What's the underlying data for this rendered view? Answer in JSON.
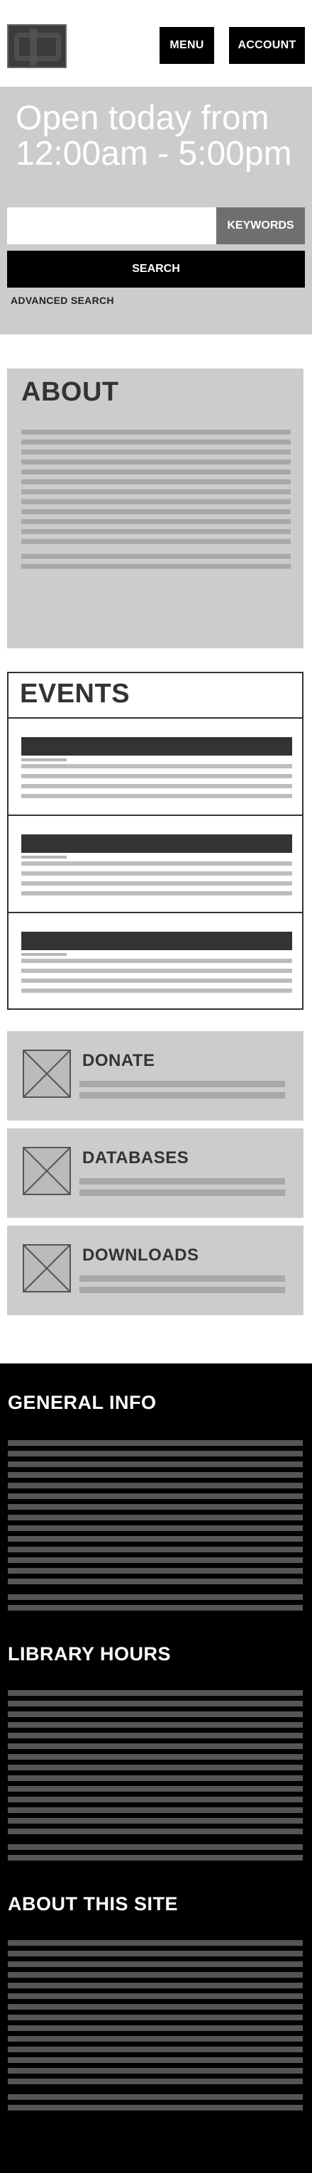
{
  "header": {
    "logo_name": "library-logo",
    "menu_label": "MENU",
    "account_label": "ACCOUNT"
  },
  "hero": {
    "title": "Open today from 12:00am - 5:00pm",
    "search_placeholder": "",
    "keywords_label": "KEYWORDS",
    "search_label": "SEARCH",
    "advanced_search_label": "ADVANCED SEARCH"
  },
  "about": {
    "title": "ABOUT"
  },
  "events": {
    "title": "EVENTS"
  },
  "cards": [
    {
      "title": "DONATE",
      "icon": "image-placeholder-icon"
    },
    {
      "title": "DATABASES",
      "icon": "image-placeholder-icon"
    },
    {
      "title": "DOWNLOADS",
      "icon": "image-placeholder-icon"
    }
  ],
  "footer": {
    "general_info_title": "GENERAL INFO",
    "library_hours_title": "LIBRARY HOURS",
    "about_site_title": "ABOUT THIS SITE"
  },
  "colors": {
    "hero_bg": "#cccccc",
    "button_black": "#000000",
    "keywords_gray": "#6f6f6f",
    "footer_bg": "#000000"
  }
}
